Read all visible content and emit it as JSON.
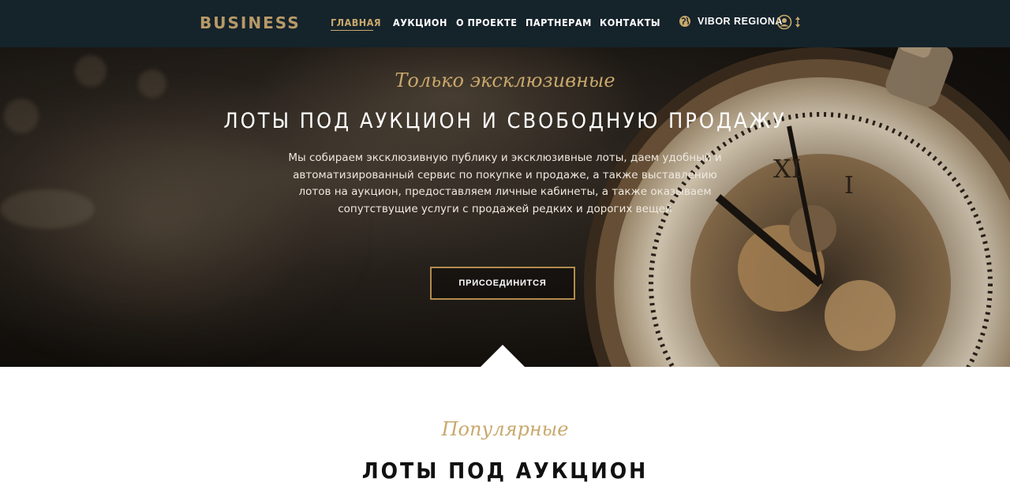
{
  "brand": {
    "logo": "BUSINESS"
  },
  "nav": {
    "items": [
      {
        "label": "ГЛАВНАЯ",
        "active": true
      },
      {
        "label": "АУКЦИОН",
        "active": false
      },
      {
        "label": "О ПРОЕКТЕ",
        "active": false
      },
      {
        "label": "ПАРТНЕРАМ",
        "active": false
      },
      {
        "label": "КОНТАКТЫ",
        "active": false
      }
    ],
    "region_label": "VIBOR REGIONA",
    "region_icon": "globe-icon",
    "user_icon": "user-circle-icon",
    "toggle_icon": "updown-arrow-icon"
  },
  "hero": {
    "script": "Только эксклюзивные",
    "title": "ЛОТЫ ПОД АУКЦИОН И СВОБОДНУЮ ПРОДАЖУ",
    "text": "Мы собираем эксклюзивную публику и эксклюзивные лоты, даем удобный и автоматизированный сервис по покупке и продаже, а также выставлению лотов на аукцион, предоставляем личные кабинеты, а также оказываем сопутствущие услуги с продажей редких и дорогих вещей",
    "button_label": "ПРИСОЕДИНИТСЯ"
  },
  "popular": {
    "script": "Популярные",
    "title": "ЛОТЫ ПОД АУКЦИОН"
  },
  "colors": {
    "navbar_bg": "#15232b",
    "gold": "#c9a86c",
    "logo": "#b79a68",
    "button_border": "#b38b4d"
  }
}
